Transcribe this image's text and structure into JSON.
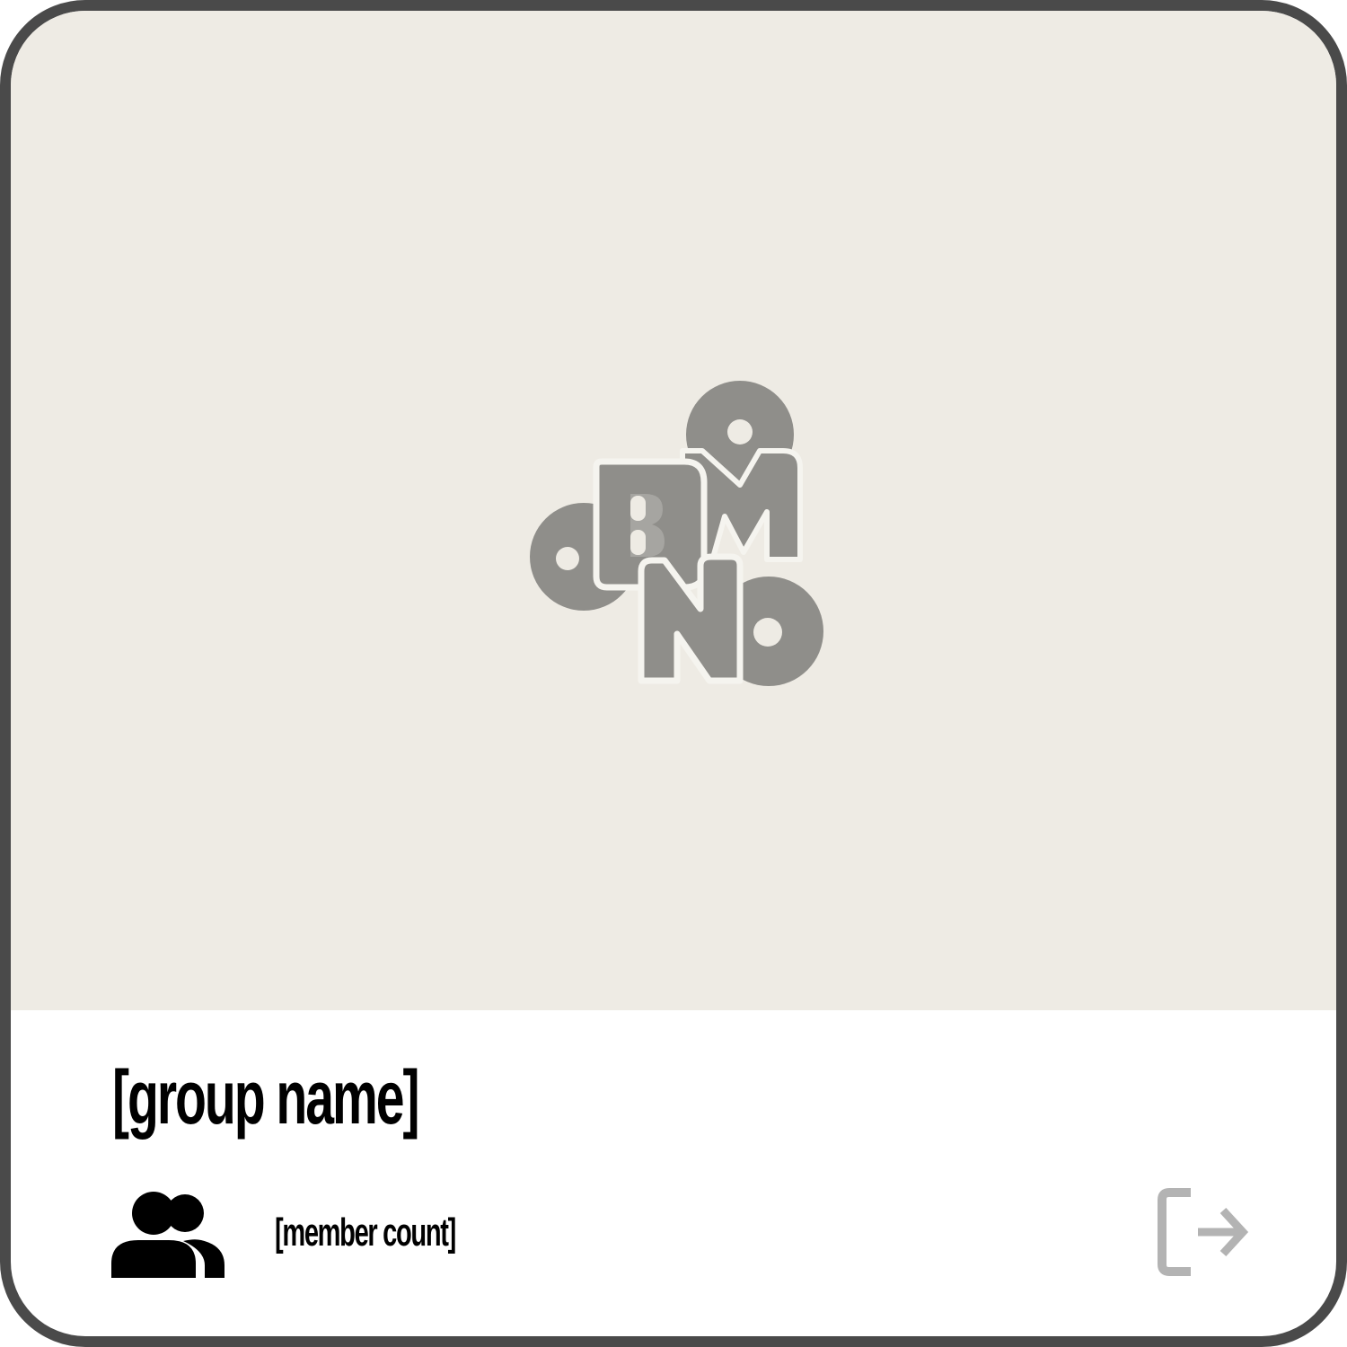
{
  "group": {
    "name": "[group name]",
    "member_count": "[member count]"
  },
  "logo": {
    "text": "BMNO"
  },
  "icons": {
    "members": "people-icon",
    "leave": "exit-icon"
  },
  "colors": {
    "cover_background": "#eeebe4",
    "logo_gray": "#8f8e8a",
    "card_border": "#4a4a4a",
    "exit_icon": "#b3b3b3",
    "text": "#000000"
  }
}
